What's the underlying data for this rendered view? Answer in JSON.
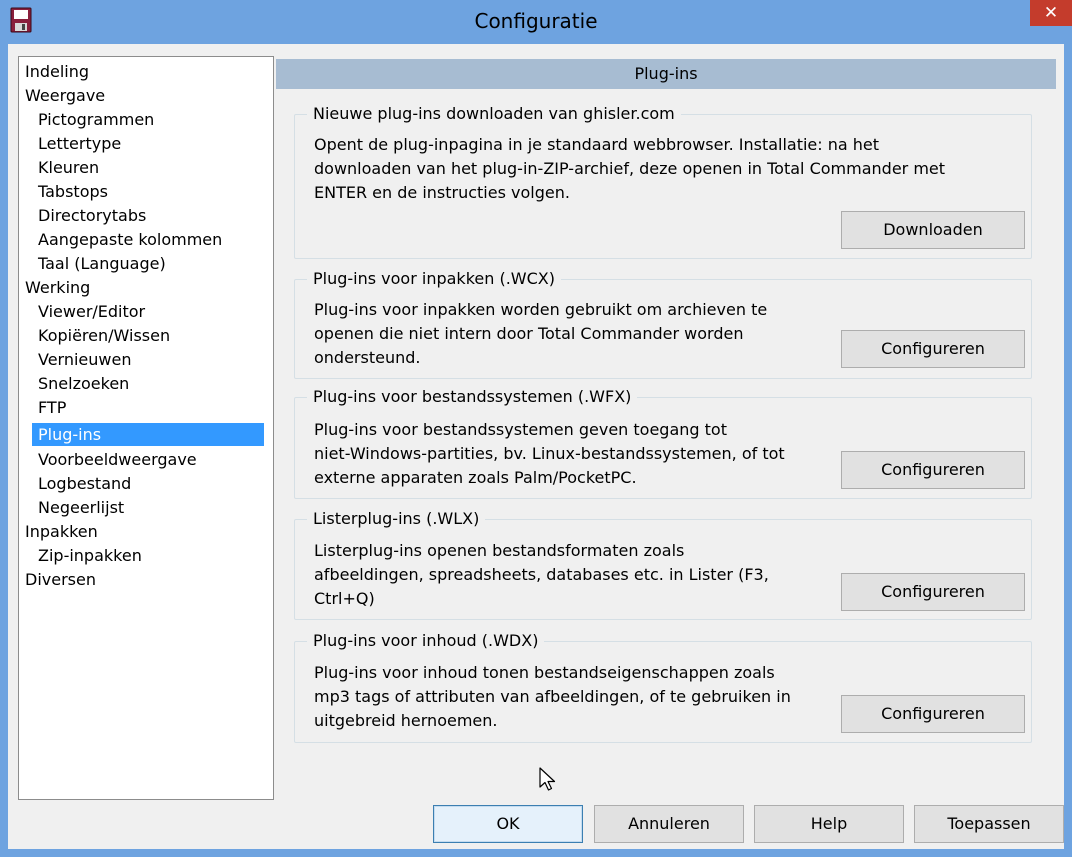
{
  "window": {
    "title": "Configuratie",
    "close_glyph": "✕",
    "app_icon": "floppy-disk-icon",
    "accent_color": "#6ea3e0",
    "close_color": "#c43c2c"
  },
  "tree": {
    "items": [
      "Indeling",
      "Weergave",
      "Pictogrammen",
      "Lettertype",
      "Kleuren",
      "Tabstops",
      "Directorytabs",
      "Aangepaste kolommen",
      "Taal (Language)",
      "Werking",
      "Viewer/Editor",
      "Kopiëren/Wissen",
      "Vernieuwen",
      "Snelzoeken",
      "FTP",
      "Plug-ins",
      "Voorbeeldweergave",
      "Logbestand",
      "Negeerlijst",
      "Inpakken",
      "Zip-inpakken",
      "Diversen"
    ],
    "selected": "Plug-ins"
  },
  "panel": {
    "title": "Plug-ins",
    "groups": [
      {
        "title": "Nieuwe plug-ins downloaden van ghisler.com",
        "description": "Opent de plug-inpagina in je standaard webbrowser. Installatie: na het\ndownloaden van het plug-in-ZIP-archief, deze openen in Total Commander met\nENTER en de instructies volgen.",
        "button": "Downloaden"
      },
      {
        "title": "Plug-ins voor inpakken (.WCX)",
        "description": "Plug-ins voor inpakken worden gebruikt om archieven te\nopenen die niet intern door Total Commander worden\nondersteund.",
        "button": "Configureren"
      },
      {
        "title": "Plug-ins voor bestandssystemen (.WFX)",
        "description": "Plug-ins voor bestandssystemen geven toegang tot\nniet-Windows-partities, bv. Linux-bestandssystemen, of tot\nexterne apparaten zoals Palm/PocketPC.",
        "button": "Configureren"
      },
      {
        "title": "Listerplug-ins (.WLX)",
        "description": "Listerplug-ins openen bestandsformaten zoals\nafbeeldingen, spreadsheets, databases etc. in Lister (F3,\nCtrl+Q)",
        "button": "Configureren"
      },
      {
        "title": "Plug-ins voor inhoud (.WDX)",
        "description": "Plug-ins voor inhoud tonen bestandseigenschappen zoals\nmp3 tags of attributen van afbeeldingen, of te gebruiken in\nuitgebreid hernoemen.",
        "button": "Configureren"
      }
    ]
  },
  "footer": {
    "ok": "OK",
    "cancel": "Annuleren",
    "help": "Help",
    "apply": "Toepassen"
  }
}
